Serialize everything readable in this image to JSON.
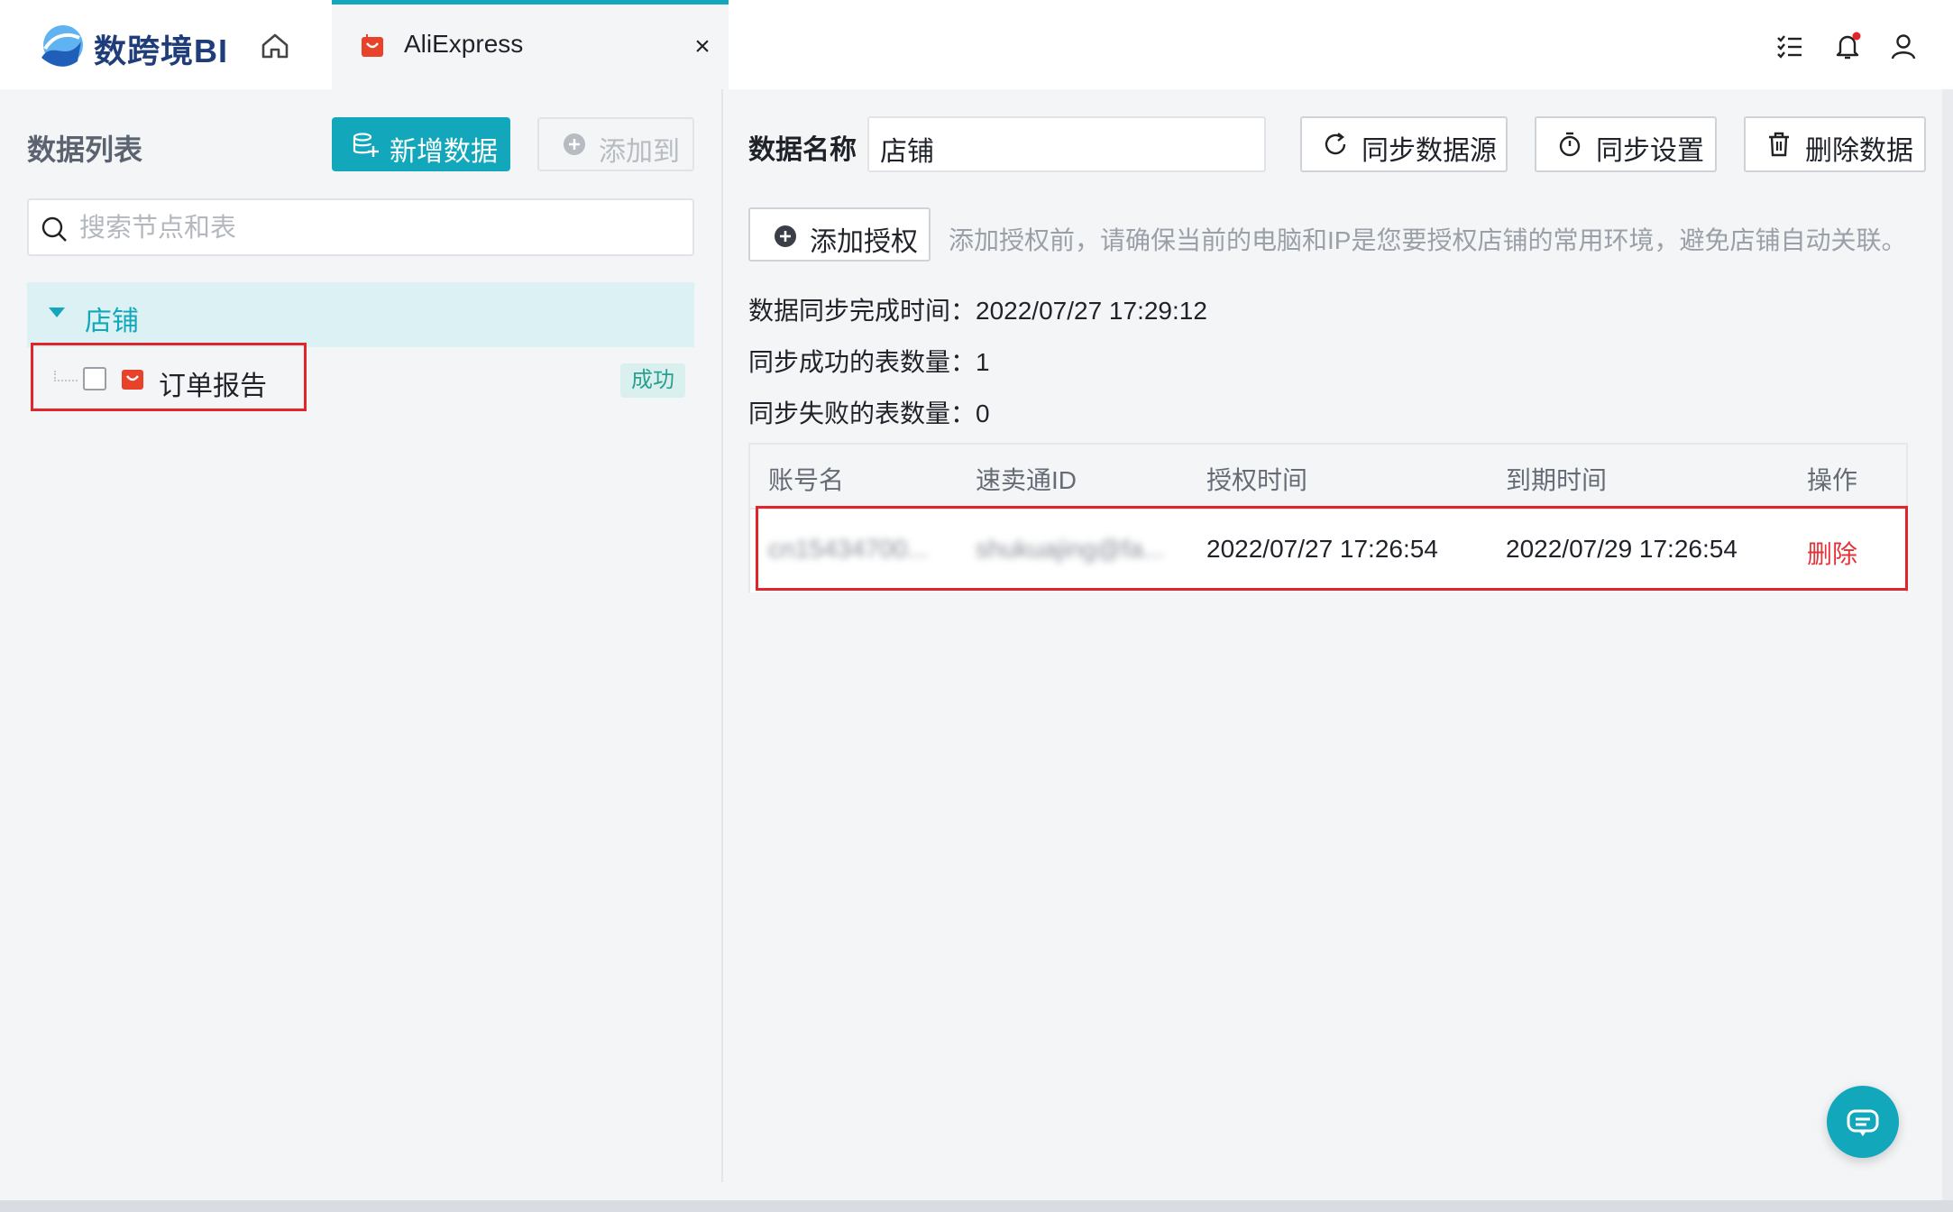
{
  "app": {
    "logo_text": "数跨境BI"
  },
  "tab": {
    "label": "AliExpress",
    "close": "×"
  },
  "left": {
    "title": "数据列表",
    "add_button": "新增数据",
    "add_to_button": "添加到",
    "search_placeholder": "搜索节点和表",
    "tree": {
      "node_label": "店铺",
      "child_label": "订单报告",
      "child_status": "成功"
    }
  },
  "right": {
    "name_label": "数据名称",
    "name_value": "店铺",
    "sync_source_button": "同步数据源",
    "sync_settings_button": "同步设置",
    "delete_data_button": "删除数据",
    "add_auth_button": "添加授权",
    "hint": "添加授权前，请确保当前的电脑和IP是您要授权店铺的常用环境，避免店铺自动关联。",
    "sync_time_label": "数据同步完成时间：",
    "sync_time_value": "2022/07/27 17:29:12",
    "sync_success_label": "同步成功的表数量：",
    "sync_success_value": "1",
    "sync_fail_label": "同步失败的表数量：",
    "sync_fail_value": "0",
    "table": {
      "headers": [
        "账号名",
        "速卖通ID",
        "授权时间",
        "到期时间",
        "操作"
      ],
      "rows": [
        [
          "cn15434700...",
          "shukuajing@fa...",
          "2022/07/27 17:26:54",
          "2022/07/29 17:26:54",
          "删除"
        ]
      ]
    }
  },
  "colors": {
    "accent": "#13a7bb",
    "danger": "#e3343a",
    "highlight": "#e3242b",
    "aliexpress": "#e8432a"
  }
}
